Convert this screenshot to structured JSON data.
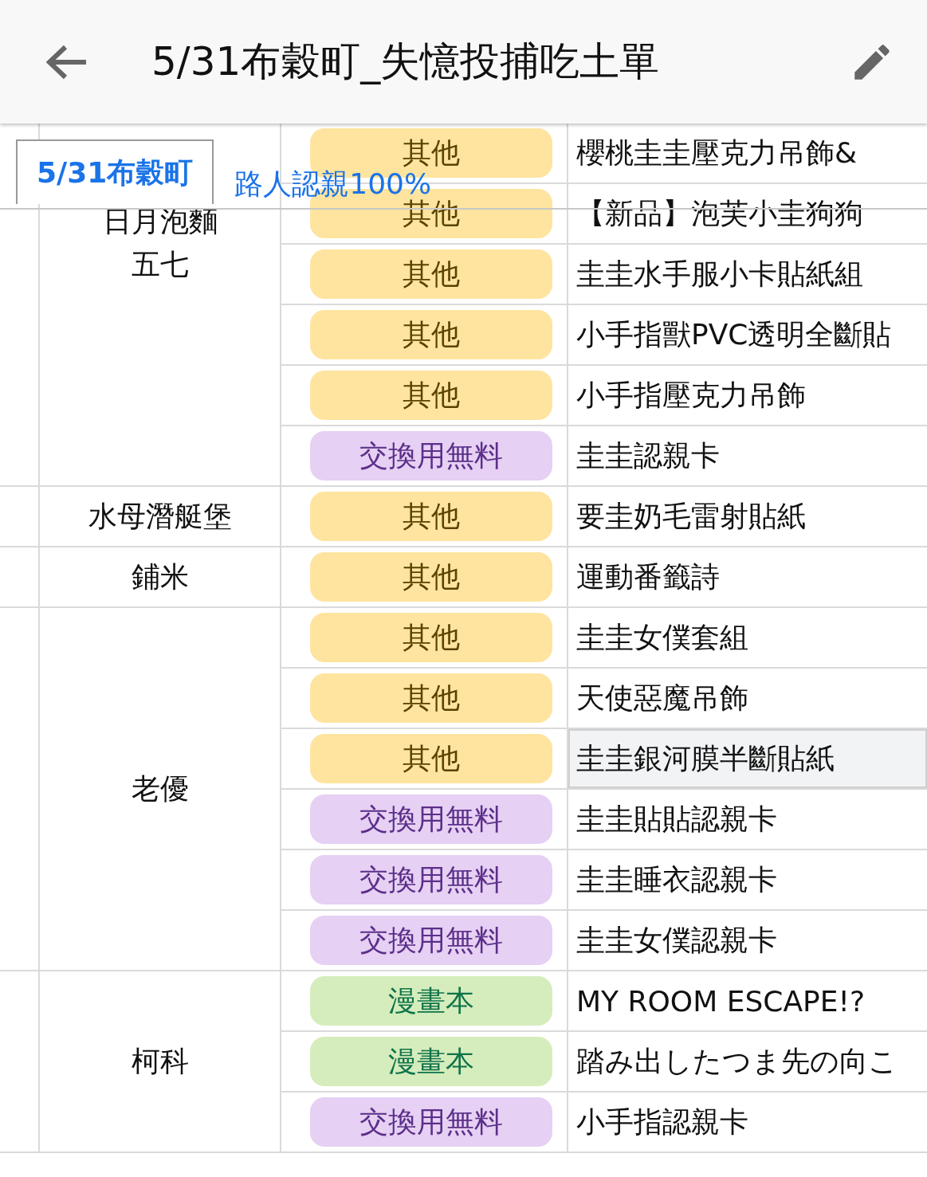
{
  "header": {
    "title": "5/31布穀町_失憶投捕吃土單"
  },
  "sheet_tabs": [
    {
      "label": "5/31布穀町",
      "selected": true
    },
    {
      "label": "路人認親100%",
      "selected": false
    }
  ],
  "groups": [
    {
      "names": [
        "日月泡麵",
        "五七"
      ],
      "items": [
        {
          "category": "其他",
          "kind": "other",
          "item": "櫻桃圭圭壓克力吊飾&",
          "selected": false
        },
        {
          "category": "其他",
          "kind": "other",
          "item": "【新品】泡芙小圭狗狗",
          "selected": false
        },
        {
          "category": "其他",
          "kind": "other",
          "item": "圭圭水手服小卡貼紙組",
          "selected": false
        },
        {
          "category": "其他",
          "kind": "other",
          "item": "小手指獸PVC透明全斷貼",
          "selected": false
        },
        {
          "category": "其他",
          "kind": "other",
          "item": "小手指壓克力吊飾",
          "selected": false
        },
        {
          "category": "交換用無料",
          "kind": "free",
          "item": "圭圭認親卡",
          "selected": false
        }
      ]
    },
    {
      "names": [
        "水母潛艇堡"
      ],
      "items": [
        {
          "category": "其他",
          "kind": "other",
          "item": "要圭奶毛雷射貼紙",
          "selected": false
        }
      ]
    },
    {
      "names": [
        "鋪米"
      ],
      "items": [
        {
          "category": "其他",
          "kind": "other",
          "item": "運動番籤詩",
          "selected": false
        }
      ]
    },
    {
      "names": [
        "老優"
      ],
      "items": [
        {
          "category": "其他",
          "kind": "other",
          "item": "圭圭女僕套組",
          "selected": false
        },
        {
          "category": "其他",
          "kind": "other",
          "item": "天使惡魔吊飾",
          "selected": false
        },
        {
          "category": "其他",
          "kind": "other",
          "item": "圭圭銀河膜半斷貼紙",
          "selected": true
        },
        {
          "category": "交換用無料",
          "kind": "free",
          "item": "圭圭貼貼認親卡",
          "selected": false
        },
        {
          "category": "交換用無料",
          "kind": "free",
          "item": "圭圭睡衣認親卡",
          "selected": false
        },
        {
          "category": "交換用無料",
          "kind": "free",
          "item": "圭圭女僕認親卡",
          "selected": false
        }
      ]
    },
    {
      "names": [
        "柯科"
      ],
      "items": [
        {
          "category": "漫畫本",
          "kind": "comic",
          "item": "MY ROOM ESCAPE!?",
          "selected": false
        },
        {
          "category": "漫畫本",
          "kind": "comic",
          "item": "踏み出したつま先の向こ",
          "selected": false
        },
        {
          "category": "交換用無料",
          "kind": "free",
          "item": "小手指認親卡",
          "selected": false
        }
      ]
    }
  ]
}
